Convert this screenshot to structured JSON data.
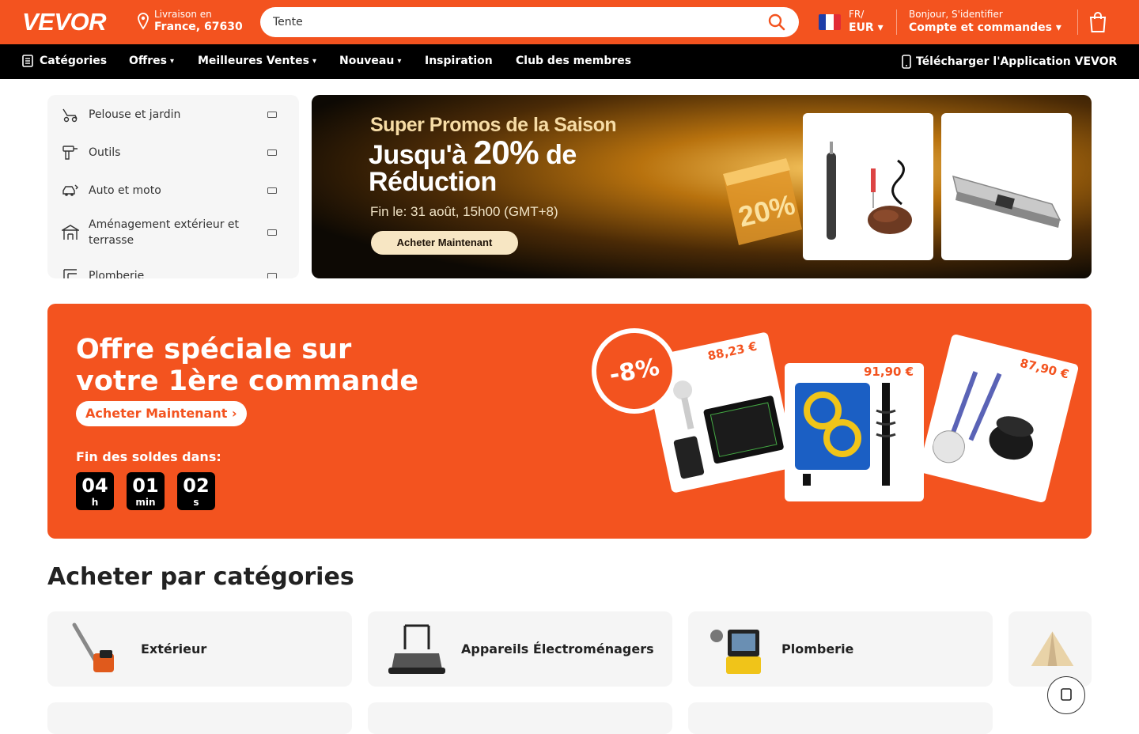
{
  "header": {
    "logo": "VEVOR",
    "delivery_line1": "Livraison en",
    "delivery_line2": "France, 67630",
    "search_value": "Tente",
    "lang_line1": "FR/",
    "lang_line2": "EUR ▾",
    "account_line1": "Bonjour, S'identifier",
    "account_line2": "Compte et commandes ▾"
  },
  "nav": {
    "categories": "Catégories",
    "offres": "Offres",
    "meilleures": "Meilleures Ventes",
    "nouveau": "Nouveau",
    "inspiration": "Inspiration",
    "club": "Club des membres",
    "app": "Télécharger l'Application VEVOR",
    "caret": "▾"
  },
  "sidebar": {
    "items": [
      {
        "label": "Pelouse et jardin",
        "icon": "lawn-mower-icon"
      },
      {
        "label": "Outils",
        "icon": "drill-icon"
      },
      {
        "label": "Auto et moto",
        "icon": "car-icon"
      },
      {
        "label": "Aménagement extérieur et terrasse",
        "icon": "gazebo-icon"
      },
      {
        "label": "Plomberie",
        "icon": "pipe-icon"
      }
    ]
  },
  "banner": {
    "line1": "Super Promos de la Saison",
    "line2a": "Jusqu'à ",
    "line2b": "20%",
    "line2c": " de Réduction",
    "line3": "Fin le: 31 août, 15h00 (GMT+8)",
    "button": "Acheter Maintenant",
    "badge": "20%"
  },
  "promo": {
    "title_line1": "Offre spéciale sur",
    "title_line2": "votre 1ère commande",
    "button": "Acheter Maintenant ›",
    "countdown_label": "Fin des soldes dans:",
    "timer": [
      {
        "value": "04",
        "unit": "h"
      },
      {
        "value": "01",
        "unit": "min"
      },
      {
        "value": "02",
        "unit": "s"
      }
    ],
    "discount": "-8%",
    "prices": [
      "88,23 €",
      "91,90 €",
      "87,90 €"
    ]
  },
  "categories_section": {
    "title": "Acheter par catégories",
    "items": [
      {
        "label": "Extérieur",
        "icon": "chainsaw-icon"
      },
      {
        "label": "Appareils Électroménagers",
        "icon": "sweeper-icon"
      },
      {
        "label": "Plomberie",
        "icon": "inspection-camera-icon"
      },
      {
        "label": "",
        "icon": "tent-icon"
      }
    ]
  },
  "colors": {
    "brand": "#f3531f",
    "nav_bg": "#000000"
  }
}
